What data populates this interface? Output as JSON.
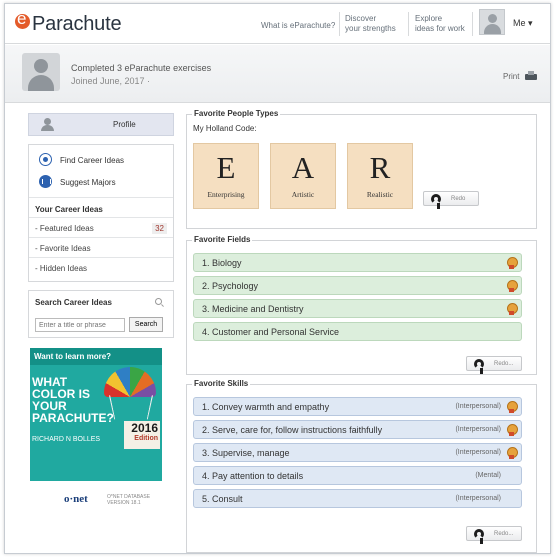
{
  "header": {
    "logo_text": "Parachute",
    "nav": {
      "what": "What is eParachute?",
      "discover_line1": "Discover",
      "discover_line2": "your strengths",
      "explore_line1": "Explore",
      "explore_line2": "ideas for work"
    },
    "user_menu_label": "Me ▾"
  },
  "banner": {
    "completed": "Completed 3 eParachute exercises",
    "joined": "Joined June, 2017 ·",
    "print_label": "Print"
  },
  "sidebar": {
    "profile_label": "Profile",
    "links": {
      "find": "Find Career Ideas",
      "majors": "Suggest Majors"
    },
    "ideas": {
      "heading": "Your Career Ideas",
      "featured": "- Featured Ideas",
      "featured_count": "32",
      "favorite": "- Favorite Ideas",
      "hidden": "- Hidden Ideas"
    },
    "search": {
      "heading": "Search Career Ideas",
      "placeholder": "Enter a title or phrase",
      "button": "Search"
    },
    "ad": {
      "question": "Want to learn more?",
      "title": "WHAT COLOR IS YOUR PARACHUTE?",
      "author": "RICHARD N BOLLES",
      "year": "2016",
      "edition": "Edition"
    },
    "onet": {
      "logo": "o·net",
      "line1": "O*NET DATABASE",
      "line2": "VERSION 18.1"
    }
  },
  "people": {
    "title": "Favorite People Types",
    "holland_label": "My Holland Code:",
    "tiles": [
      {
        "letter": "E",
        "word": "Enterprising"
      },
      {
        "letter": "A",
        "word": "Artistic"
      },
      {
        "letter": "R",
        "word": "Realistic"
      }
    ],
    "redo": "Redo"
  },
  "fields": {
    "title": "Favorite Fields",
    "items": [
      {
        "label": "1. Biology"
      },
      {
        "label": "2. Psychology"
      },
      {
        "label": "3. Medicine and Dentistry"
      },
      {
        "label": "4. Customer and Personal Service"
      }
    ],
    "redo": "Redo..."
  },
  "skills": {
    "title": "Favorite Skills",
    "items": [
      {
        "label": "1. Convey warmth and empathy",
        "tag": "(Interpersonal)"
      },
      {
        "label": "2. Serve, care for, follow instructions faithfully",
        "tag": "(Interpersonal)"
      },
      {
        "label": "3. Supervise, manage",
        "tag": "(Interpersonal)"
      },
      {
        "label": "4. Pay attention to details",
        "tag": "(Mental)"
      },
      {
        "label": "5. Consult",
        "tag": "(Interpersonal)"
      }
    ],
    "redo": "Redo..."
  },
  "colors": {
    "brand": "#e45b2a",
    "field_row": "#dceedc",
    "skill_row": "#dfe8f4",
    "tile": "#f5dfc1",
    "ad": "#20a9a0"
  }
}
